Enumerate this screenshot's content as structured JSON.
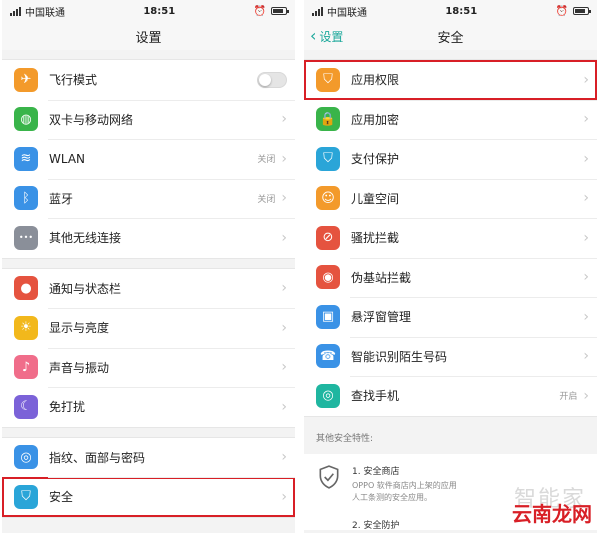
{
  "left_screen": {
    "status": {
      "carrier": "中国联通",
      "time": "18:51"
    },
    "title": "设置",
    "groups": [
      [
        {
          "icon": "airplane-icon",
          "label": "飞行模式",
          "control": "toggle",
          "color": "#f39a2b"
        },
        {
          "icon": "cellular-icon",
          "label": "双卡与移动网络",
          "control": "arrow",
          "color": "#39b44a"
        },
        {
          "icon": "wifi-icon",
          "label": "WLAN",
          "value": "关闭",
          "control": "arrow",
          "color": "#3a92e6"
        },
        {
          "icon": "bluetooth-icon",
          "label": "蓝牙",
          "value": "关闭",
          "control": "arrow",
          "color": "#3a92e6"
        },
        {
          "icon": "more-icon",
          "label": "其他无线连接",
          "control": "arrow",
          "color": "#8a8f99"
        }
      ],
      [
        {
          "icon": "notification-icon",
          "label": "通知与状态栏",
          "control": "arrow",
          "color": "#e5533f"
        },
        {
          "icon": "brightness-icon",
          "label": "显示与亮度",
          "control": "arrow",
          "color": "#f2b81c"
        },
        {
          "icon": "sound-icon",
          "label": "声音与振动",
          "control": "arrow",
          "color": "#f06d8a"
        },
        {
          "icon": "moon-icon",
          "label": "免打扰",
          "control": "arrow",
          "color": "#7b62d8"
        }
      ],
      [
        {
          "icon": "fingerprint-icon",
          "label": "指纹、面部与密码",
          "control": "arrow",
          "color": "#3a92e6"
        },
        {
          "icon": "shield-icon",
          "label": "安全",
          "control": "arrow",
          "color": "#2aa5d8",
          "highlight": true
        }
      ]
    ]
  },
  "right_screen": {
    "status": {
      "carrier": "中国联通",
      "time": "18:51"
    },
    "back_label": "设置",
    "title": "安全",
    "items": [
      {
        "icon": "app-permission-icon",
        "label": "应用权限",
        "color": "#f39a2b",
        "highlight": true
      },
      {
        "icon": "lock-icon",
        "label": "应用加密",
        "color": "#39b44a"
      },
      {
        "icon": "payment-shield-icon",
        "label": "支付保护",
        "color": "#2aa5d8"
      },
      {
        "icon": "child-icon",
        "label": "儿童空间",
        "color": "#f39a2b"
      },
      {
        "icon": "block-icon",
        "label": "骚扰拦截",
        "color": "#e5533f"
      },
      {
        "icon": "radio-tower-icon",
        "label": "伪基站拦截",
        "color": "#e5533f"
      },
      {
        "icon": "floating-window-icon",
        "label": "悬浮窗管理",
        "color": "#3a92e6"
      },
      {
        "icon": "caller-id-icon",
        "label": "智能识别陌生号码",
        "color": "#3a92e6"
      },
      {
        "icon": "find-phone-icon",
        "label": "查找手机",
        "value": "开启",
        "color": "#1fb6a0"
      }
    ],
    "other_features_caption": "其他安全特性:",
    "features": [
      {
        "title": "1. 安全商店",
        "desc_line1": "OPPO 软件商店内上架的应用",
        "desc_line2": "人工条测的安全应用。"
      },
      {
        "title": "2. 安全防护"
      }
    ]
  },
  "watermarks": {
    "a": "智能家",
    "b": "云南龙网"
  }
}
